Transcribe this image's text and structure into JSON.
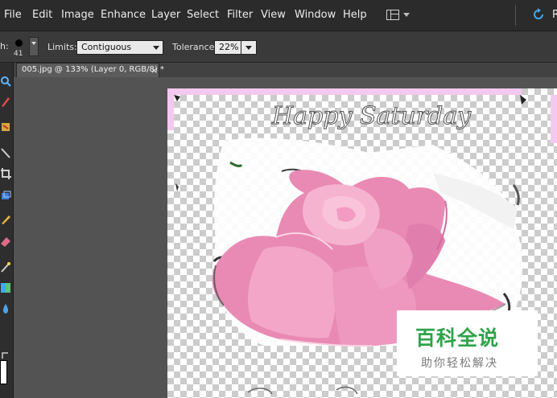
{
  "menu": {
    "items": [
      "File",
      "Edit",
      "Image",
      "Enhance",
      "Layer",
      "Select",
      "Filter",
      "View",
      "Window",
      "Help"
    ],
    "right_label": "R"
  },
  "options": {
    "brush_label_fragment": "h:",
    "brush_size": "41",
    "limits_label": "Limits:",
    "limits_value": "Contiguous",
    "tolerance_label": "Tolerance:",
    "tolerance_value": "22%"
  },
  "document": {
    "tab_label": "005.jpg @ 133% (Layer 0, RGB/8) *",
    "close_glyph": "×"
  },
  "canvas": {
    "text_top": "Happy Saturday"
  },
  "watermark": {
    "logo": "百科全说",
    "subtitle": "助你轻松解决"
  },
  "icons": {
    "workspace": "workspace-layout-icon",
    "refresh": "refresh-icon"
  },
  "colors": {
    "menubar_bg": "#2b2b2b",
    "options_bg": "#3a3a3a",
    "workspace_bg": "#535353",
    "accent_blue": "#3fa9f5",
    "rose_pink": "#f29bc2",
    "watermark_green": "#2fa34a"
  }
}
